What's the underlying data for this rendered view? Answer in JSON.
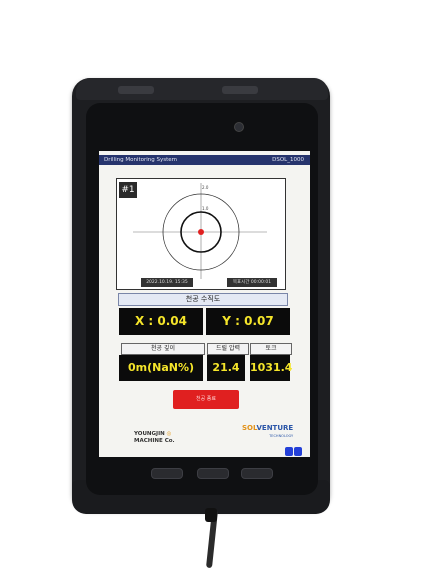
{
  "app": {
    "title": "Drilling Monitoring System",
    "device_id": "DSOL_1000"
  },
  "target": {
    "hole_label": "#1",
    "ring_label_outer": "2.0",
    "ring_label_inner": "1.0",
    "date": "2022.10.19.   15:35",
    "elapsed": "목표시간 00:00:01"
  },
  "section_title": "천공 수직도",
  "x_value": "X : 0.04",
  "y_value": "Y : 0.07",
  "labels": {
    "depth": "천공 깊이",
    "pressure": "드릴 압력",
    "torque": "토크"
  },
  "values": {
    "depth": "0m(NaN%)",
    "pressure": "21.4",
    "torque": "1031.4"
  },
  "stop_button_label": "천공 종료",
  "brand_left": {
    "name": "YOUNGJIN",
    "sub": "MACHINE Co."
  },
  "brand_right": {
    "sol": "SOL",
    "vt": "VENTURE",
    "sub": "TECHNOLOGY"
  },
  "colors": {
    "titlebar": "#26346d",
    "value_text": "#f5e52a",
    "value_bg": "#0b0b0b",
    "stop_button": "#e02020",
    "target_dot": "#e02020",
    "nav_dot": "#2440d8"
  }
}
